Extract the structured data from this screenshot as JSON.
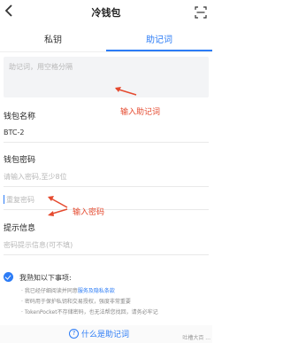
{
  "header": {
    "title": "冷钱包"
  },
  "tabs": [
    {
      "label": "私钥"
    },
    {
      "label": "助记词"
    }
  ],
  "mnemonic": {
    "placeholder": "助记词，用空格分隔"
  },
  "annotations": {
    "mnemonic_hint": "输入助记词",
    "password_hint": "输入密码"
  },
  "form": {
    "wallet_name_label": "钱包名称",
    "wallet_name_value": "BTC-2",
    "password_label": "钱包密码",
    "password_placeholder": "请输入密码,至少8位",
    "repeat_placeholder": "重复密码",
    "hint_label": "提示信息",
    "hint_placeholder": "密码提示信息(可不填)"
  },
  "agreement": {
    "title": "我熟知以下事项:",
    "bullet1_prefix": "· 我已经仔细阅读并同意",
    "bullet1_link": "服务及隐私条款",
    "bullet2": "· 密码用于保护私钥和交易授权，强度非常重要",
    "bullet3": "· TokenPocket不存储密码，也无法帮您找回，请务必牢记"
  },
  "footer": {
    "help_text": "什么是助记词",
    "watermark": "吐槽大百 ..."
  },
  "colors": {
    "accent": "#2c7cf6",
    "annotation": "#e54a2f"
  }
}
